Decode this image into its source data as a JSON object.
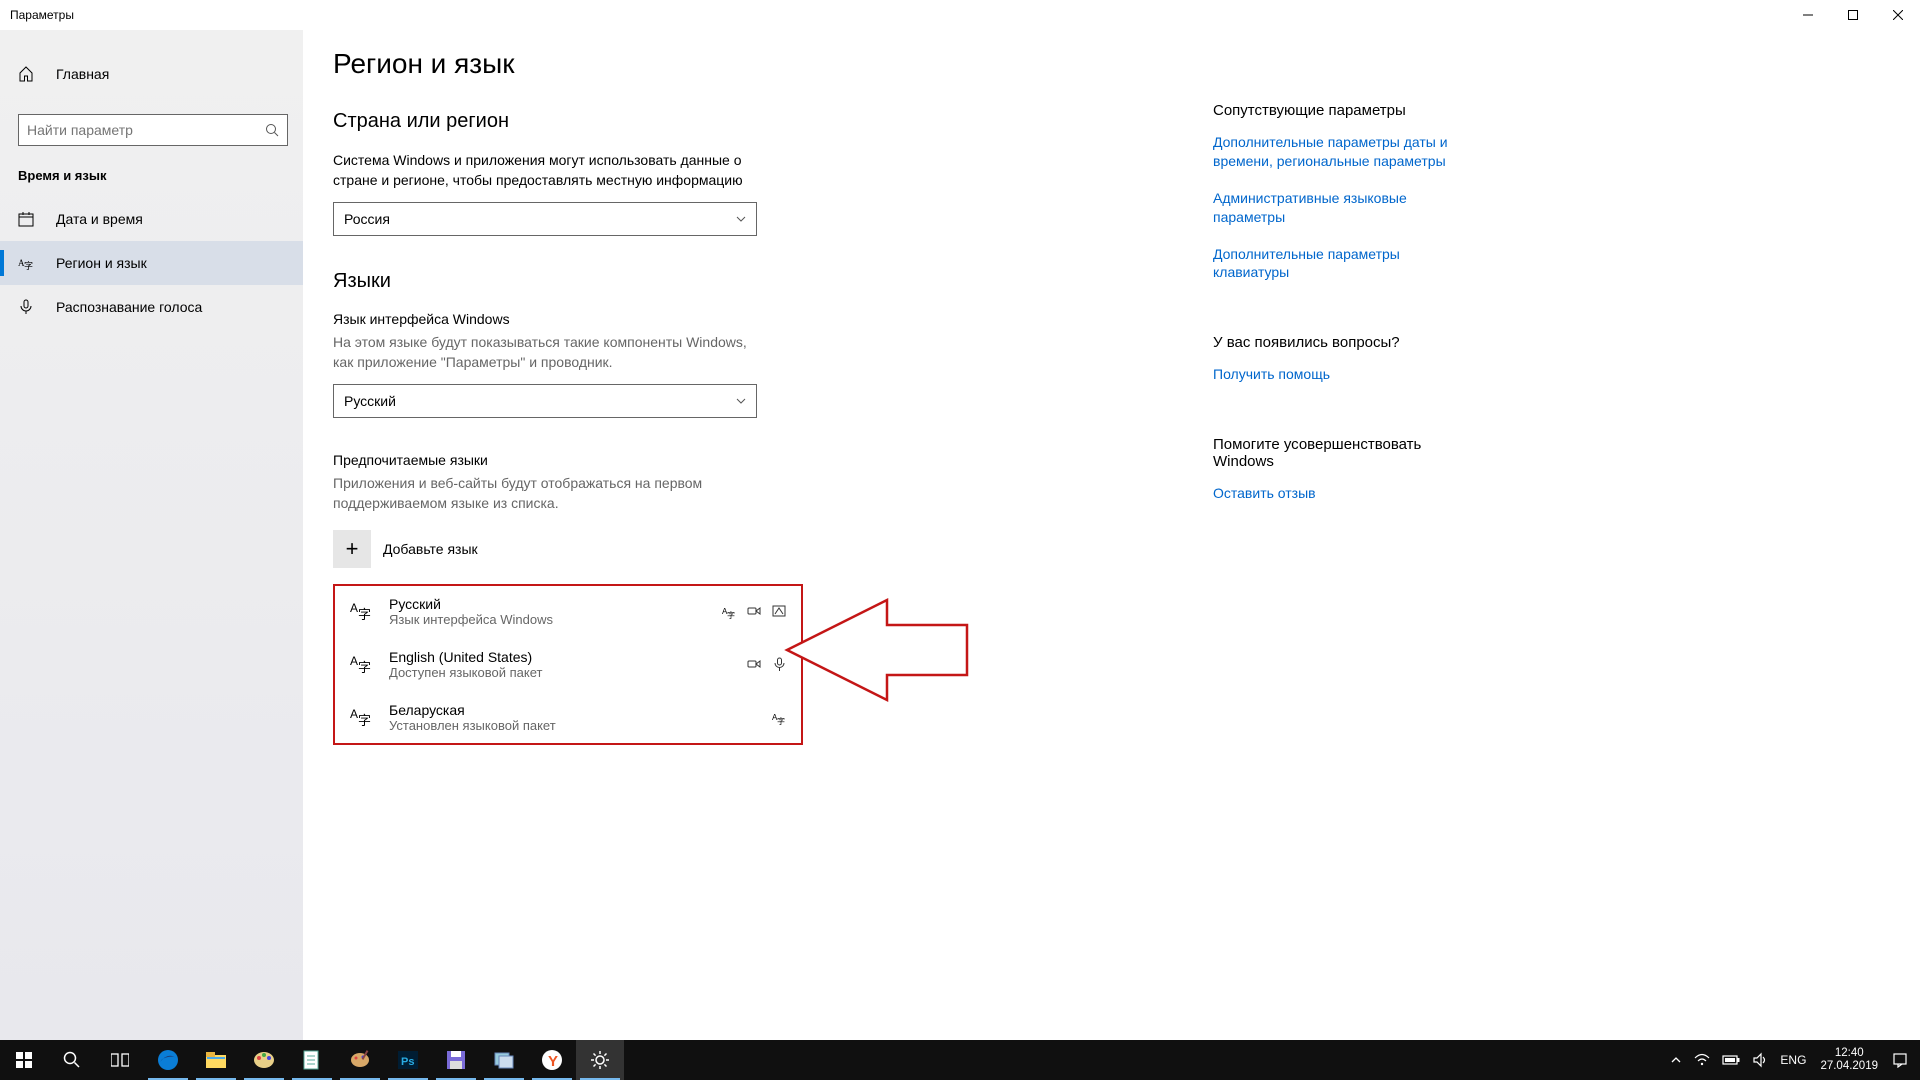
{
  "window": {
    "title": "Параметры"
  },
  "sidebar": {
    "home": "Главная",
    "search_placeholder": "Найти параметр",
    "category": "Время и язык",
    "items": [
      {
        "label": "Дата и время"
      },
      {
        "label": "Регион и язык"
      },
      {
        "label": "Распознавание голоса"
      }
    ]
  },
  "page": {
    "title": "Регион и язык",
    "section_region": {
      "heading": "Страна или регион",
      "desc": "Система Windows и приложения могут использовать данные о стране и регионе, чтобы предоставлять местную информацию",
      "value": "Россия"
    },
    "section_lang": {
      "heading": "Языки",
      "display_lang_label": "Язык интерфейса Windows",
      "display_lang_desc": "На этом языке будут показываться такие компоненты Windows, как приложение \"Параметры\" и проводник.",
      "display_lang_value": "Русский",
      "pref_label": "Предпочитаемые языки",
      "pref_desc": "Приложения и веб-сайты будут отображаться на первом поддерживаемом языке из списка.",
      "add_label": "Добавьте язык",
      "languages": [
        {
          "name": "Русский",
          "sub": "Язык интерфейса Windows"
        },
        {
          "name": "English (United States)",
          "sub": "Доступен языковой пакет"
        },
        {
          "name": "Беларуская",
          "sub": "Установлен языковой пакет"
        }
      ]
    }
  },
  "aside": {
    "related_heading": "Сопутствующие параметры",
    "links": [
      "Дополнительные параметры даты и времени, региональные параметры",
      "Административные языковые параметры",
      "Дополнительные параметры клавиатуры"
    ],
    "questions_heading": "У вас появились вопросы?",
    "help_link": "Получить помощь",
    "improve_heading": "Помогите усовершенствовать Windows",
    "feedback_link": "Оставить отзыв"
  },
  "taskbar": {
    "lang": "ENG",
    "time": "12:40",
    "date": "27.04.2019"
  }
}
